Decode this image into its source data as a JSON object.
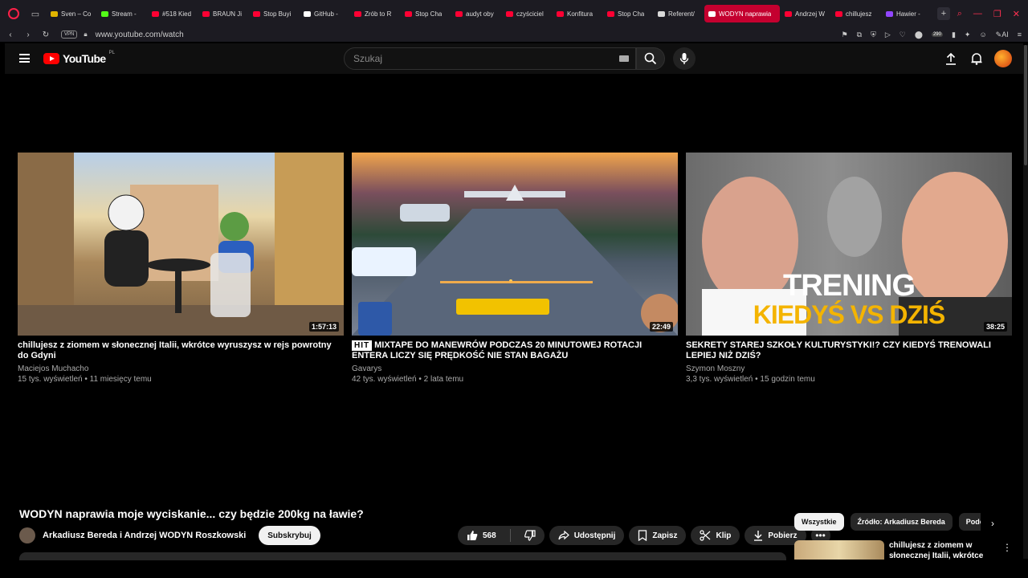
{
  "browser": {
    "tabs": [
      {
        "label": "Sven – Co",
        "color": "#e0b400"
      },
      {
        "label": "Stream - ",
        "color": "#53fc18"
      },
      {
        "label": "#518 Kied",
        "color": "#ff0033"
      },
      {
        "label": "BRAUN Ji",
        "color": "#ff0033"
      },
      {
        "label": "Stop Buyi",
        "color": "#ff0033"
      },
      {
        "label": "GitHub - ",
        "color": "#ffffff"
      },
      {
        "label": "Zrób to R",
        "color": "#ff0033"
      },
      {
        "label": "Stop Cha",
        "color": "#ff0033"
      },
      {
        "label": "audyt oby",
        "color": "#ff0033"
      },
      {
        "label": "czyściciel",
        "color": "#ff0033"
      },
      {
        "label": "Konfitura",
        "color": "#ff0033"
      },
      {
        "label": "Stop Cha",
        "color": "#ff0033"
      },
      {
        "label": "Referent/",
        "color": "#d9d9d9"
      },
      {
        "label": "WODYN naprawia",
        "color": "#ffffff",
        "active": true
      },
      {
        "label": "Andrzej W",
        "color": "#ff0033"
      },
      {
        "label": "chillujesz",
        "color": "#ff0033"
      },
      {
        "label": "Hawier - ",
        "color": "#9146ff"
      }
    ],
    "new_tab": "+",
    "vpn": "VPN",
    "url": "www.youtube.com/watch",
    "badge": "290",
    "ai_label": "AI"
  },
  "youtube": {
    "logo_text": "YouTube",
    "country": "PL",
    "search_placeholder": "Szukaj"
  },
  "endscreen": [
    {
      "title": "chillujesz z ziomem w słonecznej Italii, wkrótce wyruszysz w rejs powrotny do Gdyni",
      "channel": "Maciejos Muchacho",
      "meta": "15 tys. wyświetleń • 11 miesięcy temu",
      "duration": "1:57:13",
      "thumb_text": ""
    },
    {
      "title": "MIXTAPE DO MANEWRÓW PODCZAS 20 MINUTOWEJ ROTACJI ENTERA LICZY SIĘ PRĘDKOŚĆ NIE STAN BAGAŻU",
      "title_prefix": "HIT",
      "channel": "Gavarys",
      "meta": "42 tys. wyświetleń • 2 lata temu",
      "duration": "22:49"
    },
    {
      "title": "SEKRETY STAREJ SZKOŁY KULTURYSTYKI!? CZY KIEDYŚ TRENOWALI LEPIEJ NIŻ DZIŚ?",
      "channel": "Szymon Moszny",
      "meta": "3,3 tys. wyświetleń • 15 godzin temu",
      "duration": "38:25",
      "thumb_line1": "TRENING",
      "thumb_line2": "KIEDYŚ VS DZIŚ"
    }
  ],
  "video": {
    "title": "WODYN naprawia moje wyciskanie... czy będzie 200kg na ławie?",
    "owner": "Arkadiusz Bereda i Andrzej WODYN Roszkowski",
    "subscribe": "Subskrybuj",
    "likes": "568",
    "share": "Udostępnij",
    "save": "Zapisz",
    "clip": "Klip",
    "download": "Pobierz"
  },
  "sidebar": {
    "chips": [
      "Wszystkie",
      "Źródło: Arkadiusz Bereda",
      "Podobne"
    ],
    "rec_title": "chillujesz z ziomem w słonecznej Italii, wkrótce"
  }
}
